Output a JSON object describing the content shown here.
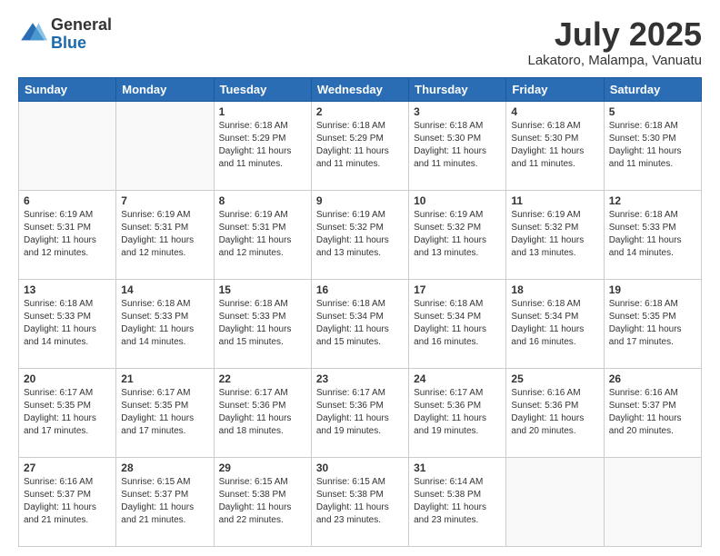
{
  "header": {
    "logo_general": "General",
    "logo_blue": "Blue",
    "month_year": "July 2025",
    "location": "Lakatoro, Malampa, Vanuatu"
  },
  "days_of_week": [
    "Sunday",
    "Monday",
    "Tuesday",
    "Wednesday",
    "Thursday",
    "Friday",
    "Saturday"
  ],
  "weeks": [
    [
      {
        "day": "",
        "info": ""
      },
      {
        "day": "",
        "info": ""
      },
      {
        "day": "1",
        "info": "Sunrise: 6:18 AM\nSunset: 5:29 PM\nDaylight: 11 hours\nand 11 minutes."
      },
      {
        "day": "2",
        "info": "Sunrise: 6:18 AM\nSunset: 5:29 PM\nDaylight: 11 hours\nand 11 minutes."
      },
      {
        "day": "3",
        "info": "Sunrise: 6:18 AM\nSunset: 5:30 PM\nDaylight: 11 hours\nand 11 minutes."
      },
      {
        "day": "4",
        "info": "Sunrise: 6:18 AM\nSunset: 5:30 PM\nDaylight: 11 hours\nand 11 minutes."
      },
      {
        "day": "5",
        "info": "Sunrise: 6:18 AM\nSunset: 5:30 PM\nDaylight: 11 hours\nand 11 minutes."
      }
    ],
    [
      {
        "day": "6",
        "info": "Sunrise: 6:19 AM\nSunset: 5:31 PM\nDaylight: 11 hours\nand 12 minutes."
      },
      {
        "day": "7",
        "info": "Sunrise: 6:19 AM\nSunset: 5:31 PM\nDaylight: 11 hours\nand 12 minutes."
      },
      {
        "day": "8",
        "info": "Sunrise: 6:19 AM\nSunset: 5:31 PM\nDaylight: 11 hours\nand 12 minutes."
      },
      {
        "day": "9",
        "info": "Sunrise: 6:19 AM\nSunset: 5:32 PM\nDaylight: 11 hours\nand 13 minutes."
      },
      {
        "day": "10",
        "info": "Sunrise: 6:19 AM\nSunset: 5:32 PM\nDaylight: 11 hours\nand 13 minutes."
      },
      {
        "day": "11",
        "info": "Sunrise: 6:19 AM\nSunset: 5:32 PM\nDaylight: 11 hours\nand 13 minutes."
      },
      {
        "day": "12",
        "info": "Sunrise: 6:18 AM\nSunset: 5:33 PM\nDaylight: 11 hours\nand 14 minutes."
      }
    ],
    [
      {
        "day": "13",
        "info": "Sunrise: 6:18 AM\nSunset: 5:33 PM\nDaylight: 11 hours\nand 14 minutes."
      },
      {
        "day": "14",
        "info": "Sunrise: 6:18 AM\nSunset: 5:33 PM\nDaylight: 11 hours\nand 14 minutes."
      },
      {
        "day": "15",
        "info": "Sunrise: 6:18 AM\nSunset: 5:33 PM\nDaylight: 11 hours\nand 15 minutes."
      },
      {
        "day": "16",
        "info": "Sunrise: 6:18 AM\nSunset: 5:34 PM\nDaylight: 11 hours\nand 15 minutes."
      },
      {
        "day": "17",
        "info": "Sunrise: 6:18 AM\nSunset: 5:34 PM\nDaylight: 11 hours\nand 16 minutes."
      },
      {
        "day": "18",
        "info": "Sunrise: 6:18 AM\nSunset: 5:34 PM\nDaylight: 11 hours\nand 16 minutes."
      },
      {
        "day": "19",
        "info": "Sunrise: 6:18 AM\nSunset: 5:35 PM\nDaylight: 11 hours\nand 17 minutes."
      }
    ],
    [
      {
        "day": "20",
        "info": "Sunrise: 6:17 AM\nSunset: 5:35 PM\nDaylight: 11 hours\nand 17 minutes."
      },
      {
        "day": "21",
        "info": "Sunrise: 6:17 AM\nSunset: 5:35 PM\nDaylight: 11 hours\nand 17 minutes."
      },
      {
        "day": "22",
        "info": "Sunrise: 6:17 AM\nSunset: 5:36 PM\nDaylight: 11 hours\nand 18 minutes."
      },
      {
        "day": "23",
        "info": "Sunrise: 6:17 AM\nSunset: 5:36 PM\nDaylight: 11 hours\nand 19 minutes."
      },
      {
        "day": "24",
        "info": "Sunrise: 6:17 AM\nSunset: 5:36 PM\nDaylight: 11 hours\nand 19 minutes."
      },
      {
        "day": "25",
        "info": "Sunrise: 6:16 AM\nSunset: 5:36 PM\nDaylight: 11 hours\nand 20 minutes."
      },
      {
        "day": "26",
        "info": "Sunrise: 6:16 AM\nSunset: 5:37 PM\nDaylight: 11 hours\nand 20 minutes."
      }
    ],
    [
      {
        "day": "27",
        "info": "Sunrise: 6:16 AM\nSunset: 5:37 PM\nDaylight: 11 hours\nand 21 minutes."
      },
      {
        "day": "28",
        "info": "Sunrise: 6:15 AM\nSunset: 5:37 PM\nDaylight: 11 hours\nand 21 minutes."
      },
      {
        "day": "29",
        "info": "Sunrise: 6:15 AM\nSunset: 5:38 PM\nDaylight: 11 hours\nand 22 minutes."
      },
      {
        "day": "30",
        "info": "Sunrise: 6:15 AM\nSunset: 5:38 PM\nDaylight: 11 hours\nand 23 minutes."
      },
      {
        "day": "31",
        "info": "Sunrise: 6:14 AM\nSunset: 5:38 PM\nDaylight: 11 hours\nand 23 minutes."
      },
      {
        "day": "",
        "info": ""
      },
      {
        "day": "",
        "info": ""
      }
    ]
  ]
}
